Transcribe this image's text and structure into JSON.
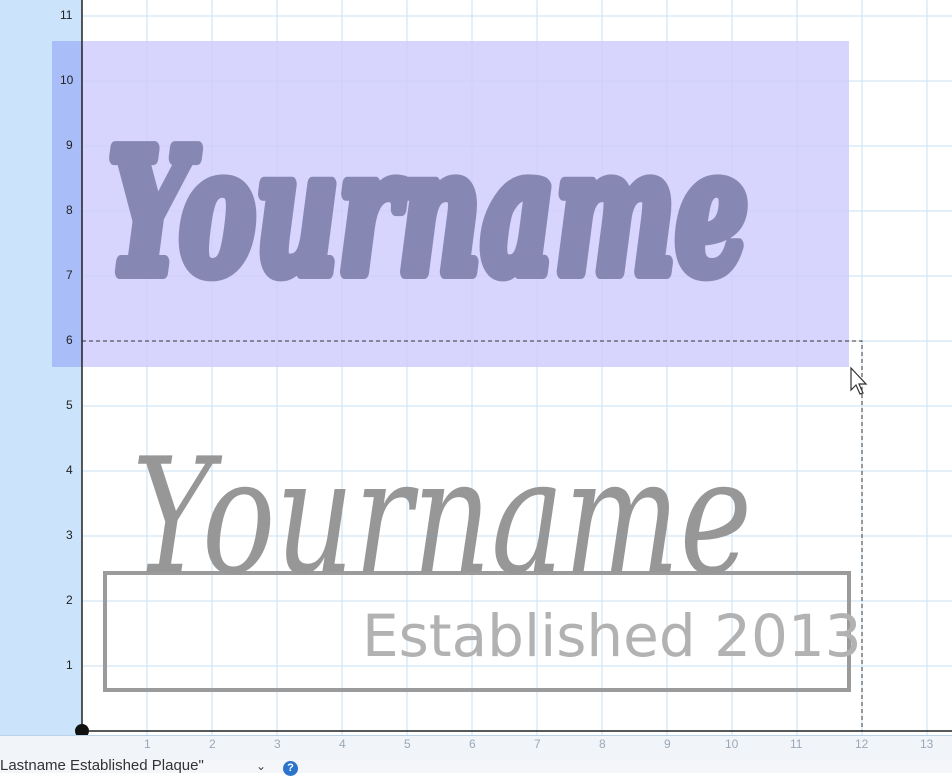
{
  "ruler": {
    "vertical_labels": [
      "1",
      "2",
      "3",
      "4",
      "5",
      "6",
      "7",
      "8",
      "9",
      "10",
      "11"
    ],
    "horizontal_labels": [
      "1",
      "2",
      "3",
      "4",
      "5",
      "6",
      "7",
      "8",
      "9",
      "10",
      "11",
      "12",
      "13"
    ]
  },
  "design": {
    "selected_script_text": "Yourname",
    "script_text": "Yourname",
    "established_text": "Established 2013"
  },
  "status_bar": {
    "file_name": "Lastname Established Plaque\"",
    "chevron": "⌄",
    "help": "?"
  },
  "colors": {
    "ruler_bg": "#cce4fb",
    "ruler_selection": "#a9bef9",
    "selection_fill": "#d0cdfd",
    "selected_shape": "#8787b4",
    "script_gray": "#979797",
    "text_gray": "#b2b2b2",
    "grid_line": "#c9e2f3",
    "help_icon": "#2c74c9"
  },
  "icons": [
    "mouse-pointer-icon",
    "chevron-down-icon",
    "help-icon",
    "origin-handle-icon"
  ]
}
